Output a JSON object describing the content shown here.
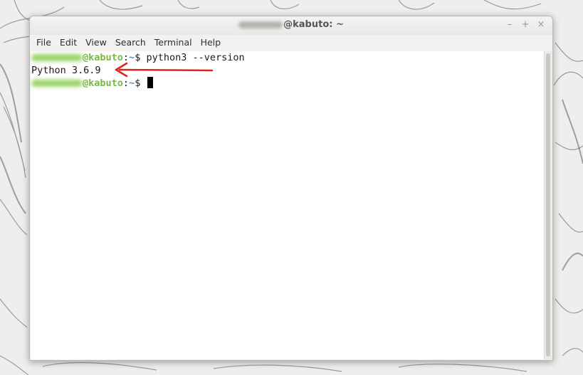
{
  "window": {
    "title_suffix": "@kabuto: ~",
    "controls": {
      "minimize": "–",
      "maximize": "+",
      "close": "×"
    }
  },
  "menubar": {
    "items": [
      "File",
      "Edit",
      "View",
      "Search",
      "Terminal",
      "Help"
    ]
  },
  "terminal": {
    "lines": [
      {
        "host": "@kabuto",
        "sep": ":",
        "path": "~",
        "prompt": "$ ",
        "command": "python3 --version"
      },
      {
        "output": "Python 3.6.9"
      },
      {
        "host": "@kabuto",
        "sep": ":",
        "path": "~",
        "prompt": "$ ",
        "command": ""
      }
    ]
  },
  "colors": {
    "host": "#7ab648",
    "path": "#5f8fb9",
    "annotation_arrow": "#e0231c"
  },
  "annotation": {
    "icon": "arrow-left-icon"
  }
}
